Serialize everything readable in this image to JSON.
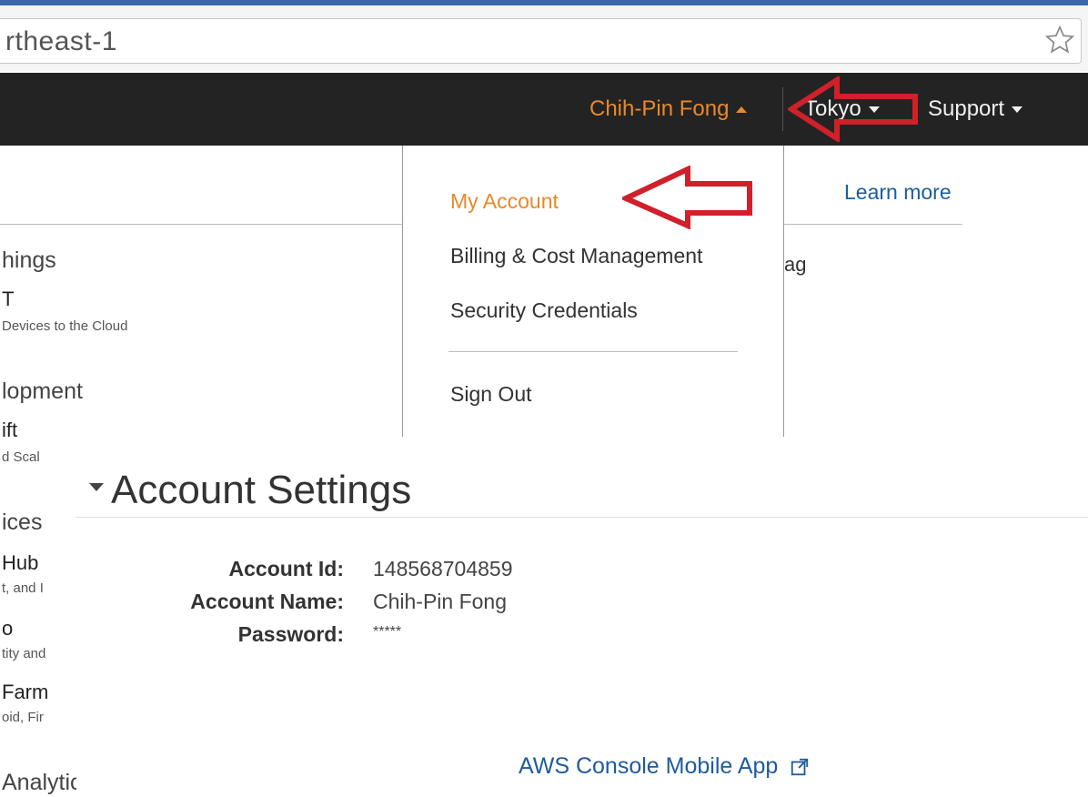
{
  "browser": {
    "url_text": "rtheast-1"
  },
  "navbar": {
    "user": "Chih-Pin Fong",
    "region": "Tokyo",
    "support": "Support"
  },
  "dropdown": {
    "items": [
      {
        "label": "My Account",
        "active": true
      },
      {
        "label": "Billing & Cost Management"
      },
      {
        "label": "Security Credentials"
      },
      {
        "label": "Sign Out"
      }
    ]
  },
  "background": {
    "learn_more": "Learn more",
    "ag_text": "ag"
  },
  "sidebar": {
    "items": [
      {
        "text": "hings",
        "style": "head"
      },
      {
        "text": "T",
        "style": "title"
      },
      {
        "text": "Devices to the Cloud",
        "style": "desc"
      },
      {
        "text": "lopment",
        "style": "head"
      },
      {
        "text": "ift",
        "style": "title"
      },
      {
        "text": "d Scal",
        "style": "desc"
      },
      {
        "text": "ices",
        "style": "head"
      },
      {
        "text": "Hub",
        "style": "title"
      },
      {
        "text": "t, and I",
        "style": "desc"
      },
      {
        "text": "o",
        "style": "title"
      },
      {
        "text": "tity and",
        "style": "desc"
      },
      {
        "text": "Farm",
        "style": "title"
      },
      {
        "text": "oid, Fir",
        "style": "desc"
      },
      {
        "text": "Analytics",
        "style": "head"
      }
    ]
  },
  "account_settings": {
    "title": "Account Settings",
    "fields": [
      {
        "label": "Account Id:",
        "value": "148568704859"
      },
      {
        "label": "Account Name:",
        "value": "Chih-Pin Fong"
      },
      {
        "label": "Password:",
        "value": "*****"
      }
    ],
    "mobile_app_link": "AWS Console Mobile App"
  },
  "colors": {
    "accent_orange": "#e8892b",
    "link_blue": "#1e5b9e",
    "navbar_bg": "#232323",
    "annotation_red": "#d0202a"
  }
}
